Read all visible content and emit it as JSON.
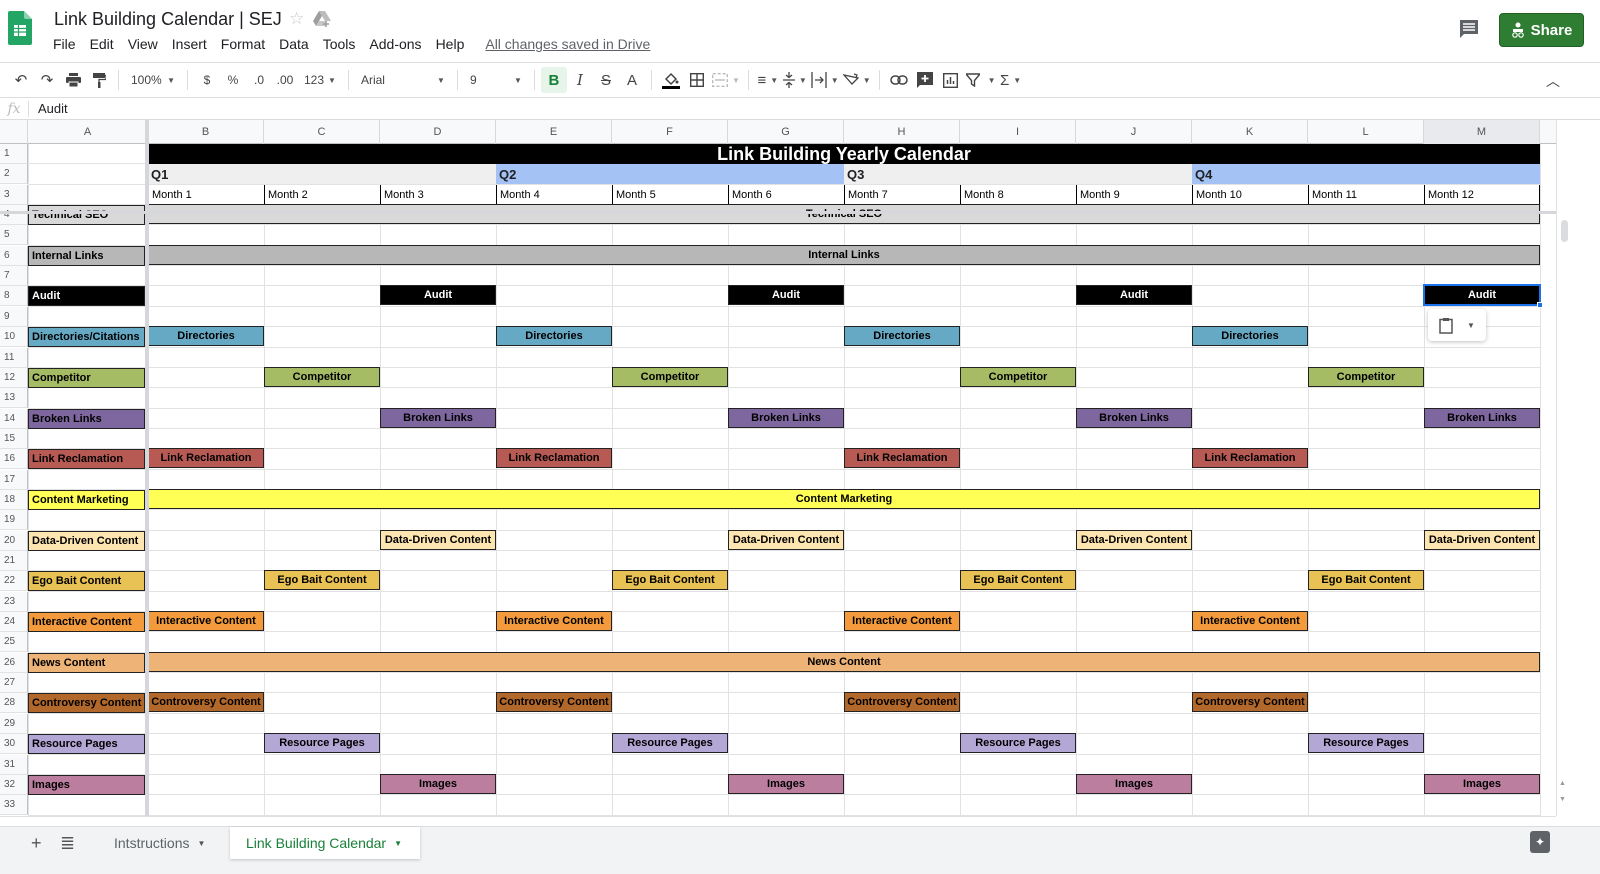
{
  "app": {
    "doc_title": "Link Building Calendar | SEJ",
    "menu": [
      "File",
      "Edit",
      "View",
      "Insert",
      "Format",
      "Data",
      "Tools",
      "Add-ons",
      "Help"
    ],
    "save_status": "All changes saved in Drive",
    "share_label": "Share"
  },
  "toolbar": {
    "zoom": "100%",
    "currency": "$",
    "percent": "%",
    "dec_decrease": ".0",
    "dec_increase": ".00",
    "more_formats": "123",
    "font": "Arial",
    "font_size": "9",
    "bold": "B",
    "italic": "I",
    "strike": "S",
    "text_color": "A",
    "sum": "Σ"
  },
  "formula_bar": {
    "fx": "fx",
    "value": "Audit"
  },
  "columns": [
    "A",
    "B",
    "C",
    "D",
    "E",
    "F",
    "G",
    "H",
    "I",
    "J",
    "K",
    "L",
    "M"
  ],
  "rows": [
    "1",
    "2",
    "3",
    "4",
    "5",
    "6",
    "7",
    "8",
    "9",
    "10",
    "11",
    "12",
    "13",
    "14",
    "15",
    "16",
    "17",
    "18",
    "19",
    "20",
    "21",
    "22",
    "23",
    "24",
    "25",
    "26",
    "27",
    "28",
    "29",
    "30",
    "31",
    "32",
    "33"
  ],
  "sheet": {
    "title": "Link Building Yearly Calendar",
    "quarters": [
      "Q1",
      "Q2",
      "Q3",
      "Q4"
    ],
    "quarter_colors": [
      "#efefef",
      "#a4c2f4",
      "#efefef",
      "#a4c2f4"
    ],
    "months": [
      "Month 1",
      "Month 2",
      "Month 3",
      "Month 4",
      "Month 5",
      "Month 6",
      "Month 7",
      "Month 8",
      "Month 9",
      "Month 10",
      "Month 11",
      "Month 12"
    ],
    "categories": [
      {
        "row": 4,
        "label": "Technical SEO",
        "color": "#d9d9d9",
        "text_color": "#000",
        "span_label": "Technical SEO",
        "full_span": true
      },
      {
        "row": 6,
        "label": "Internal Links",
        "color": "#b7b7b7",
        "text_color": "#000",
        "span_label": "Internal Links",
        "full_span": true
      },
      {
        "row": 8,
        "label": "Audit",
        "color": "#000000",
        "text_color": "#fff",
        "item": "Audit",
        "months": [
          3,
          6,
          9,
          12
        ]
      },
      {
        "row": 10,
        "label": "Directories/Citations",
        "color": "#66a9c5",
        "text_color": "#000",
        "item": "Directories",
        "months": [
          1,
          4,
          7,
          10
        ]
      },
      {
        "row": 12,
        "label": "Competitor",
        "color": "#a5bb64",
        "text_color": "#000",
        "item": "Competitor",
        "months": [
          2,
          5,
          8,
          11
        ]
      },
      {
        "row": 14,
        "label": "Broken Links",
        "color": "#7e679e",
        "text_color": "#000",
        "item": "Broken Links",
        "months": [
          3,
          6,
          9,
          12
        ]
      },
      {
        "row": 16,
        "label": "Link Reclamation",
        "color": "#b65a53",
        "text_color": "#000",
        "item": "Link Reclamation",
        "months": [
          1,
          4,
          7,
          10
        ]
      },
      {
        "row": 18,
        "label": "Content Marketing",
        "color": "#ffff55",
        "text_color": "#000",
        "span_label": "Content Marketing",
        "full_span": true
      },
      {
        "row": 20,
        "label": "Data-Driven Content",
        "color": "#fce5b0",
        "text_color": "#000",
        "item": "Data-Driven Content",
        "months": [
          3,
          6,
          9,
          12
        ]
      },
      {
        "row": 22,
        "label": "Ego Bait Content",
        "color": "#e8c254",
        "text_color": "#000",
        "item": "Ego Bait Content",
        "months": [
          2,
          5,
          8,
          11
        ]
      },
      {
        "row": 24,
        "label": "Interactive Content",
        "color": "#f39b3c",
        "text_color": "#000",
        "item": "Interactive Content",
        "months": [
          1,
          4,
          7,
          10
        ]
      },
      {
        "row": 26,
        "label": "News Content",
        "color": "#edb377",
        "text_color": "#000",
        "span_label": "News Content",
        "full_span": true
      },
      {
        "row": 28,
        "label": "Controversy Content",
        "color": "#b2682a",
        "text_color": "#000",
        "item": "Controversy Content",
        "months": [
          1,
          4,
          7,
          10
        ]
      },
      {
        "row": 30,
        "label": "Resource Pages",
        "color": "#b3a7d6",
        "text_color": "#000",
        "item": "Resource Pages",
        "months": [
          2,
          5,
          8,
          11
        ]
      },
      {
        "row": 32,
        "label": "Images",
        "color": "#bb7e9f",
        "text_color": "#000",
        "item": "Images",
        "months": [
          3,
          6,
          9,
          12
        ]
      }
    ]
  },
  "tabs": [
    {
      "label": "Intstructions",
      "active": false
    },
    {
      "label": "Link Building Calendar",
      "active": true
    }
  ]
}
